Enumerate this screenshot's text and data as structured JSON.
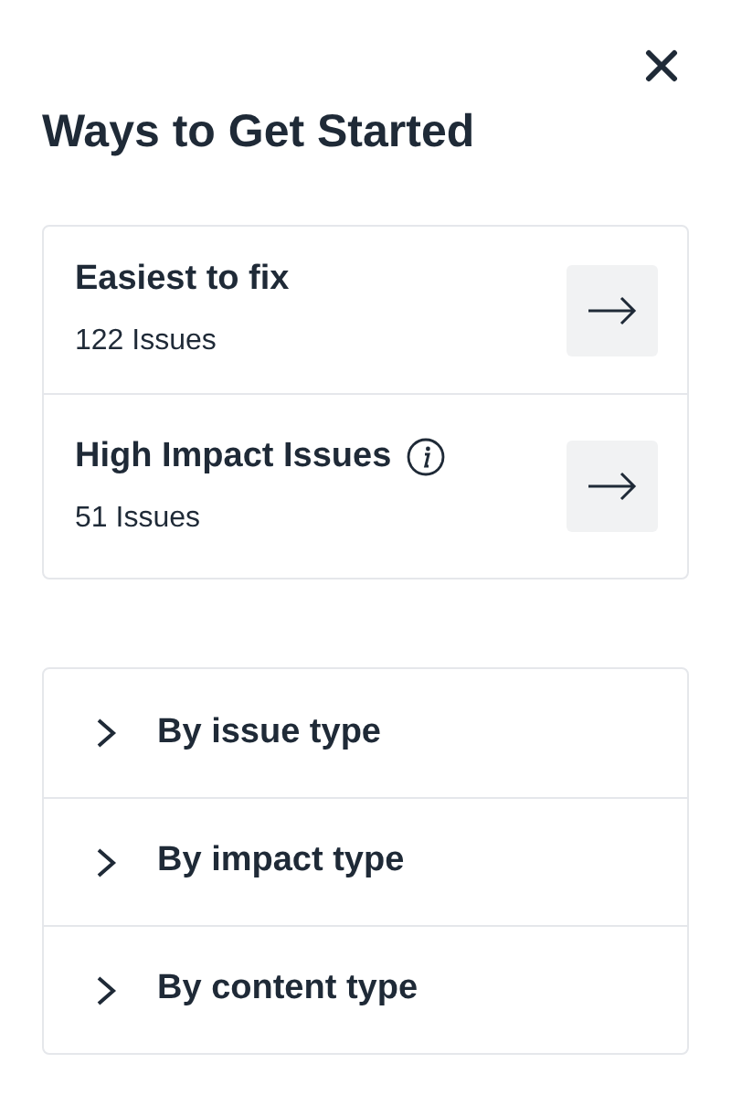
{
  "title": "Ways to Get Started",
  "shortcuts": [
    {
      "label": "Easiest to fix",
      "count": "122 Issues",
      "info": false
    },
    {
      "label": "High Impact Issues",
      "count": "51 Issues",
      "info": true
    }
  ],
  "groups": [
    {
      "label": "By issue type",
      "expanded": false
    },
    {
      "label": "By impact type",
      "expanded": false
    },
    {
      "label": "By content type",
      "expanded": false
    }
  ]
}
